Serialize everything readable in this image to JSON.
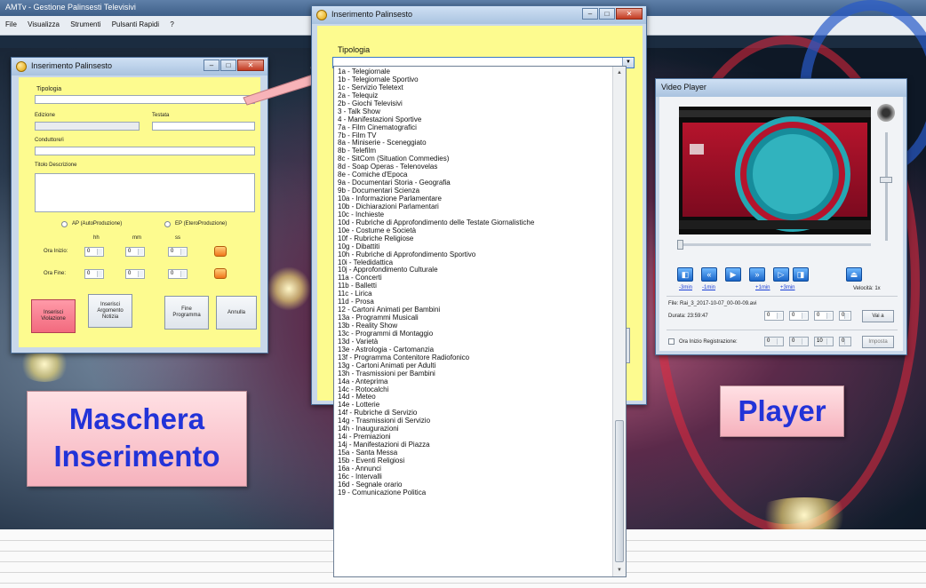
{
  "background_app": {
    "title": "AMTv - Gestione Palinsesti Televisivi",
    "menu": [
      "File",
      "Visualizza",
      "Strumenti",
      "Pulsanti Rapidi",
      "?"
    ]
  },
  "left_window": {
    "title": "Inserimento Palinsesto",
    "labels": {
      "tipologia": "Tipologia",
      "edizione": "Edizione",
      "testata": "Testata",
      "conduttore": "Conduttore/i",
      "titolo": "Titolo Descrizione",
      "ap": "AP (AutoProduzione)",
      "ep": "EP (EteroProduzione)",
      "hh": "hh",
      "mm": "mm",
      "ss": "ss",
      "ora_inizio": "Ora Inizio:",
      "ora_fine": "Ora Fine:"
    },
    "spin_values": {
      "inizio_hh": "0",
      "inizio_mm": "0",
      "inizio_ss": "0",
      "fine_hh": "0",
      "fine_mm": "0",
      "fine_ss": "0"
    },
    "buttons": {
      "inserisci_violazione": "Inserisci Violazione",
      "inserisci_argomento": "Inserisci Argomento Notizia",
      "fine_programma": "Fine Programma",
      "annulla": "Annulla"
    }
  },
  "center_window": {
    "title": "Inserimento Palinsesto",
    "tipologia_label": "Tipologia",
    "selected_index": 62,
    "options": [
      "1a - Telegiornale",
      "1b - Telegiornale Sportivo",
      "1c - Servizio Teletext",
      "2a - Telequiz",
      "2b - Giochi Televisivi",
      "3 - Talk Show",
      "4 - Manifestazioni Sportive",
      "7a - Film Cinematografici",
      "7b - Film TV",
      "8a - Miniserie - Sceneggiato",
      "8b - Telefilm",
      "8c - SitCom (Situation Commedies)",
      "8d - Soap Operas - Telenovelas",
      "8e - Comiche d'Epoca",
      "9a - Documentari Storia  - Geografia",
      "9b - Documentari Scienza",
      "10a - Informazione Parlamentare",
      "10b - Dichiarazioni Parlamentari",
      "10c - Inchieste",
      "10d - Rubriche di Approfondimento delle Testate Giornalistiche",
      "10e - Costume e Società",
      "10f - Rubriche Religiose",
      "10g - Dibattiti",
      "10h - Rubriche di Approfondimento Sportivo",
      "10i - Teledidattica",
      "10j - Approfondimento Culturale",
      "11a - Concerti",
      "11b - Balletti",
      "11c - Lirica",
      "11d - Prosa",
      "12 - Cartoni Animati per Bambini",
      "13a - Programmi Musicali",
      "13b - Reality Show",
      "13c - Programmi di Montaggio",
      "13d - Varietà",
      "13e - Astrologia - Cartomanzia",
      "13f - Programma Contenitore Radiofonico",
      "13g - Cartoni Animati per Adulti",
      "13h - Trasmissioni per Bambini",
      "14a - Anteprima",
      "14c - Rotocalchi",
      "14d - Meteo",
      "14e - Lotterie",
      "14f - Rubriche di Servizio",
      "14g - Trasmissioni di Servizio",
      "14h - Inaugurazioni",
      "14i - Premiazioni",
      "14j - Manifestazioni di Piazza",
      "15a - Santa Messa",
      "15b - Eventi Religiosi",
      "16a - Annunci",
      "16c - Intervalli",
      "16d - Segnale orario",
      "19 - Comunicazione Politica"
    ]
  },
  "player_window": {
    "title": "Video Player",
    "skip_links": [
      "-3min",
      "-1min",
      "+1min",
      "+3min"
    ],
    "velocita": "Velocità: 1x",
    "file": "File: Rai_3_2017-10-07_00-00-09.avi",
    "durata": "Durata: 23:59:47",
    "spin_values": [
      "0",
      "0",
      "0",
      "0"
    ],
    "vai_button": "Vai a",
    "ora_inizio_reg": "Ora Inizio Registrazione:",
    "reg_values": [
      "0",
      "0",
      "10",
      "0"
    ],
    "imposta_button": "Imposta"
  },
  "callouts": {
    "left": "Maschera Inserimento",
    "right": "Player"
  },
  "colors": {
    "form_yellow": "#fdfb8f",
    "callout_text": "#2233d8",
    "callout_bg": "#f6b2bd",
    "selection": "#3399ff"
  }
}
